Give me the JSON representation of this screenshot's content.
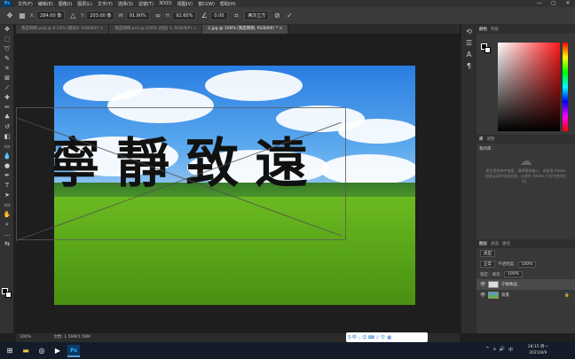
{
  "app": {
    "logo": "Ps"
  },
  "menu": [
    "文件(F)",
    "编辑(E)",
    "图像(I)",
    "图层(L)",
    "文字(Y)",
    "选择(S)",
    "滤镜(T)",
    "3D(D)",
    "视图(V)",
    "窗口(W)",
    "帮助(H)"
  ],
  "window_controls": [
    "—",
    "▢",
    "✕"
  ],
  "options": {
    "x_label": "X:",
    "x_val": "284.00 像",
    "y_label": "Y:",
    "y_val": "203.00 像",
    "w_label": "W:",
    "w_val": "91.90%",
    "h_label": "H:",
    "h_val": "92.60%",
    "angle_val": "0.00",
    "interp": "两次立方",
    "cancel_icon": "cancel-icon",
    "commit_icon": "commit-icon"
  },
  "tabs": [
    {
      "label": "我是网络.png @ 8.33% (图层0, RGB/8#) ×"
    },
    {
      "label": "我是网络.psd @ 100% (图层 1, RGB/8#) ×"
    },
    {
      "label": "2.jpg @ 100% (我是网络, RGB/8#) * ×"
    }
  ],
  "canvas_text": "寧靜致遠",
  "status": {
    "zoom": "100%",
    "doc": "文档: 1.56M/1.56M"
  },
  "panels": {
    "color_tabs": [
      "颜色",
      "色板"
    ],
    "properties_tabs": [
      "库",
      "调整"
    ],
    "library_name": "我的库",
    "library_msg": "要在我的库中使用，请将素材拖入，或使用 Adobe 创意云同步您的资源，以便在 Adobe 产品中使用它们。",
    "layer_tabs": [
      "图层",
      "通道",
      "路径"
    ],
    "kind_label": "类型",
    "blend": "正常",
    "opacity_label": "不透明度:",
    "opacity": "100%",
    "lock_label": "锁定:",
    "fill_label": "填充:",
    "fill": "100%",
    "layers": [
      {
        "name": "宁静致远",
        "selected": true
      },
      {
        "name": "背景",
        "selected": false
      }
    ]
  },
  "taskbar": {
    "time": "18:15 周一",
    "date": "2021/8/9",
    "ime": "S 中 ·, ☺ ⌨ ♪ 👕 ▦",
    "lang": "中"
  },
  "colors": {
    "accent": "#31a8ff",
    "fg": "#000000",
    "bg": "#ffffff"
  }
}
